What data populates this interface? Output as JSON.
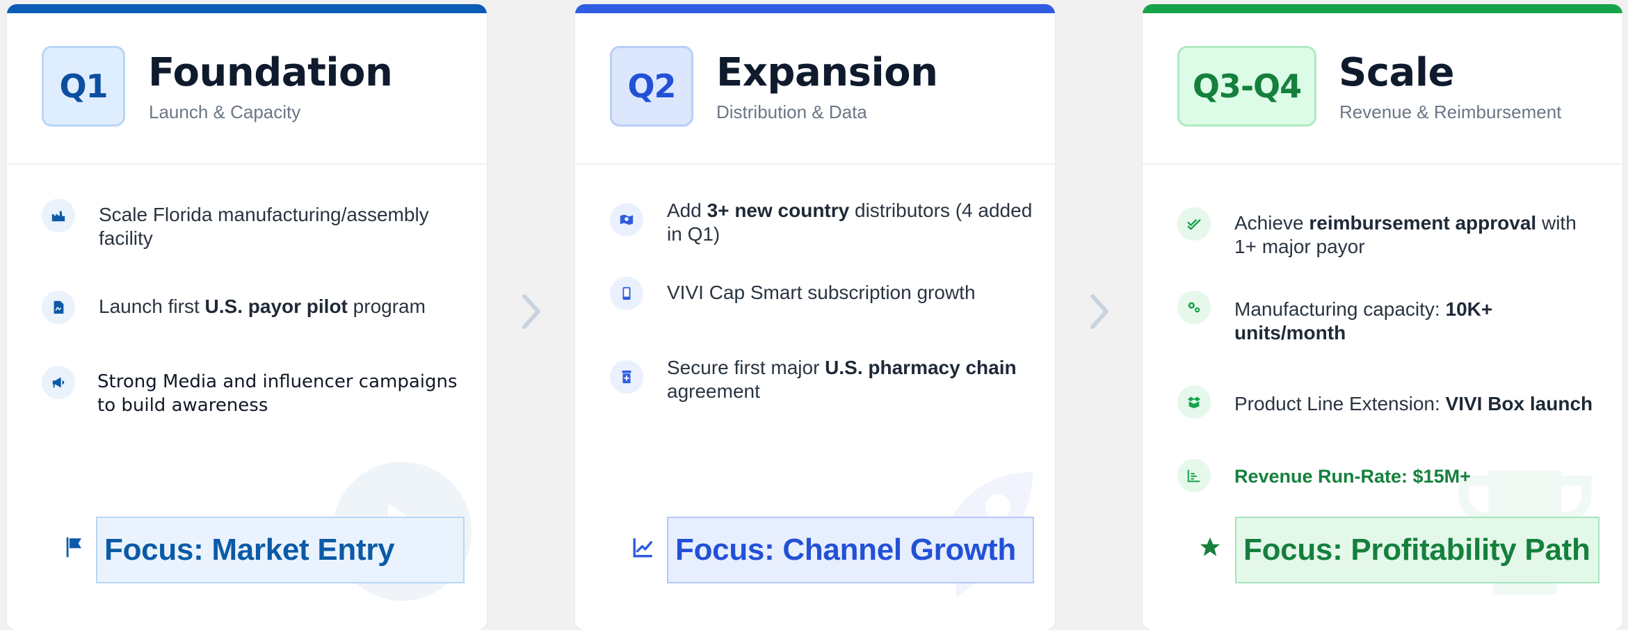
{
  "colors": {
    "blue_dark": "#0b5aa7",
    "blue": "#2f5ce0",
    "green": "#17a34a",
    "q1_topbar": "#0b5db3",
    "q2_topbar": "#2f5ce0",
    "q3_topbar": "#17a34a"
  },
  "cards": [
    {
      "badge": "Q1",
      "title": "Foundation",
      "subtitle": "Launch & Capacity",
      "items": [
        {
          "icon": "factory-icon",
          "text": "Scale Florida manufacturing/assembly facility"
        },
        {
          "icon": "document-icon",
          "pre": "Launch first ",
          "bold": "U.S. payor pilot",
          "post": " program"
        },
        {
          "icon": "megaphone-icon",
          "text": "Strong Media and influencer campaigns to build awareness"
        }
      ],
      "focus_icon": "flag-icon",
      "focus": "Focus: Market Entry",
      "watermark_icon": "play-circle-icon"
    },
    {
      "badge": "Q2",
      "title": "Expansion",
      "subtitle": "Distribution & Data",
      "items": [
        {
          "icon": "map-pin-icon",
          "pre": "Add ",
          "bold": "3+ new country",
          "post": " distributors (4 added in Q1)"
        },
        {
          "icon": "smartphone-icon",
          "text": "VIVI Cap Smart subscription growth"
        },
        {
          "icon": "pharmacy-icon",
          "pre": "Secure first major ",
          "bold": "U.S. pharmacy chain",
          "post": " agreement"
        }
      ],
      "focus_icon": "chart-line-icon",
      "focus": "Focus: Channel Growth",
      "watermark_icon": "rocket-icon"
    },
    {
      "badge": "Q3-Q4",
      "title": "Scale",
      "subtitle": "Revenue & Reimbursement",
      "items": [
        {
          "icon": "check-double-icon",
          "pre": "Achieve ",
          "bold": "reimbursement approval",
          "post": " with 1+ major payor"
        },
        {
          "icon": "gears-icon",
          "pre": "Manufacturing capacity: ",
          "bold": "10K+ units/month",
          "post": ""
        },
        {
          "icon": "box-open-icon",
          "pre": "Product Line Extension: ",
          "bold": "VIVI Box launch",
          "post": ""
        },
        {
          "icon": "bar-chart-icon",
          "text": "Revenue Run-Rate: $15M+"
        }
      ],
      "focus_icon": "star-icon",
      "focus": "Focus: Profitability Path",
      "watermark_icon": "trophy-icon"
    }
  ],
  "connectors": [
    "chevron-right-icon",
    "chevron-right-icon"
  ]
}
